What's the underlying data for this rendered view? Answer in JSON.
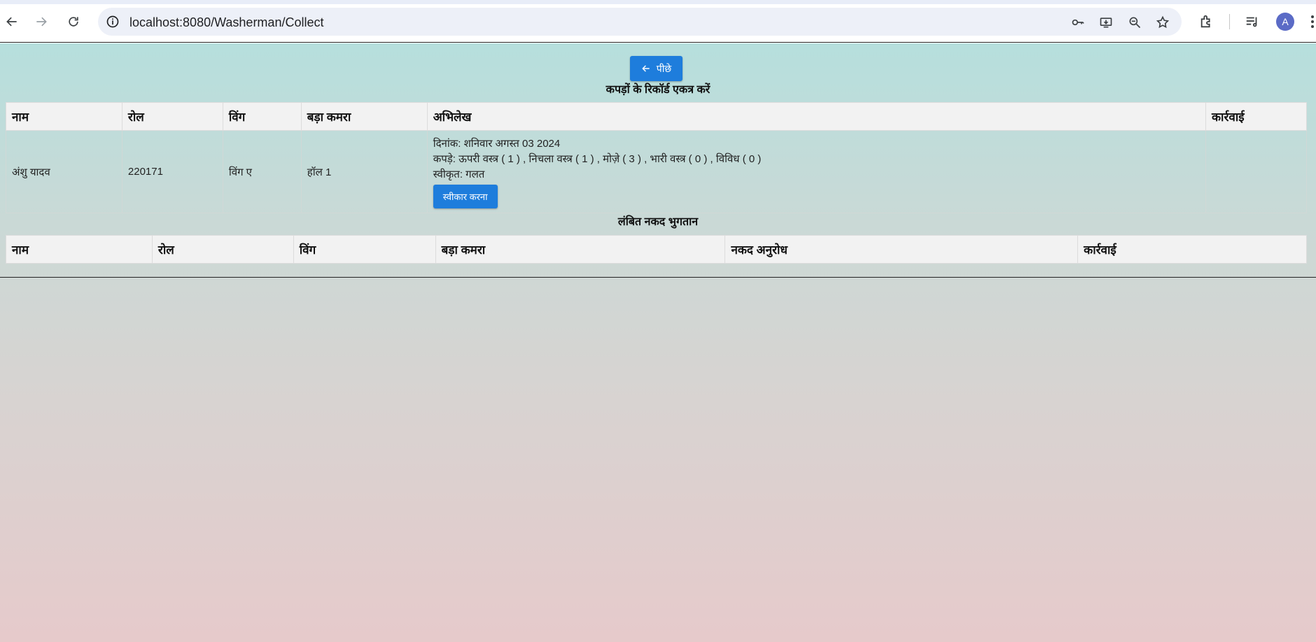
{
  "browser": {
    "url": "localhost:8080/Washerman/Collect",
    "profile_initial": "A"
  },
  "page": {
    "back_button_label": "पीछे",
    "collect_section_title": "कपड़ों के रिकॉर्ड एकत्र करें",
    "collect_table": {
      "headers": [
        "नाम",
        "रोल",
        "विंग",
        "बड़ा कमरा",
        "अभिलेख",
        "कार्रवाई"
      ],
      "rows": [
        {
          "name": "अंशु यादव",
          "roll": "220171",
          "wing": "विंग ए",
          "hall": "हॉल 1",
          "record_date": "दिनांक: शनिवार अगस्त 03 2024",
          "record_clothes": "कपड़े: ऊपरी वस्त्र ( 1 ) , निचला वस्त्र ( 1 ) , मोज़े ( 3 ) , भारी वस्त्र ( 0 ) , विविध ( 0 )",
          "record_accepted": "स्वीकृत: गलत",
          "accept_button_label": "स्वीकार करना",
          "action": ""
        }
      ]
    },
    "cash_section_title": "लंबित नकद भुगतान",
    "cash_table": {
      "headers": [
        "नाम",
        "रोल",
        "विंग",
        "बड़ा कमरा",
        "नकद अनुरोध",
        "कार्रवाई"
      ]
    }
  },
  "colors": {
    "primary_button": "#1e7ddc",
    "header_bg": "#f2f2f2",
    "gradient_top": "#b6dfdd",
    "gradient_bottom": "#e6cacb"
  }
}
